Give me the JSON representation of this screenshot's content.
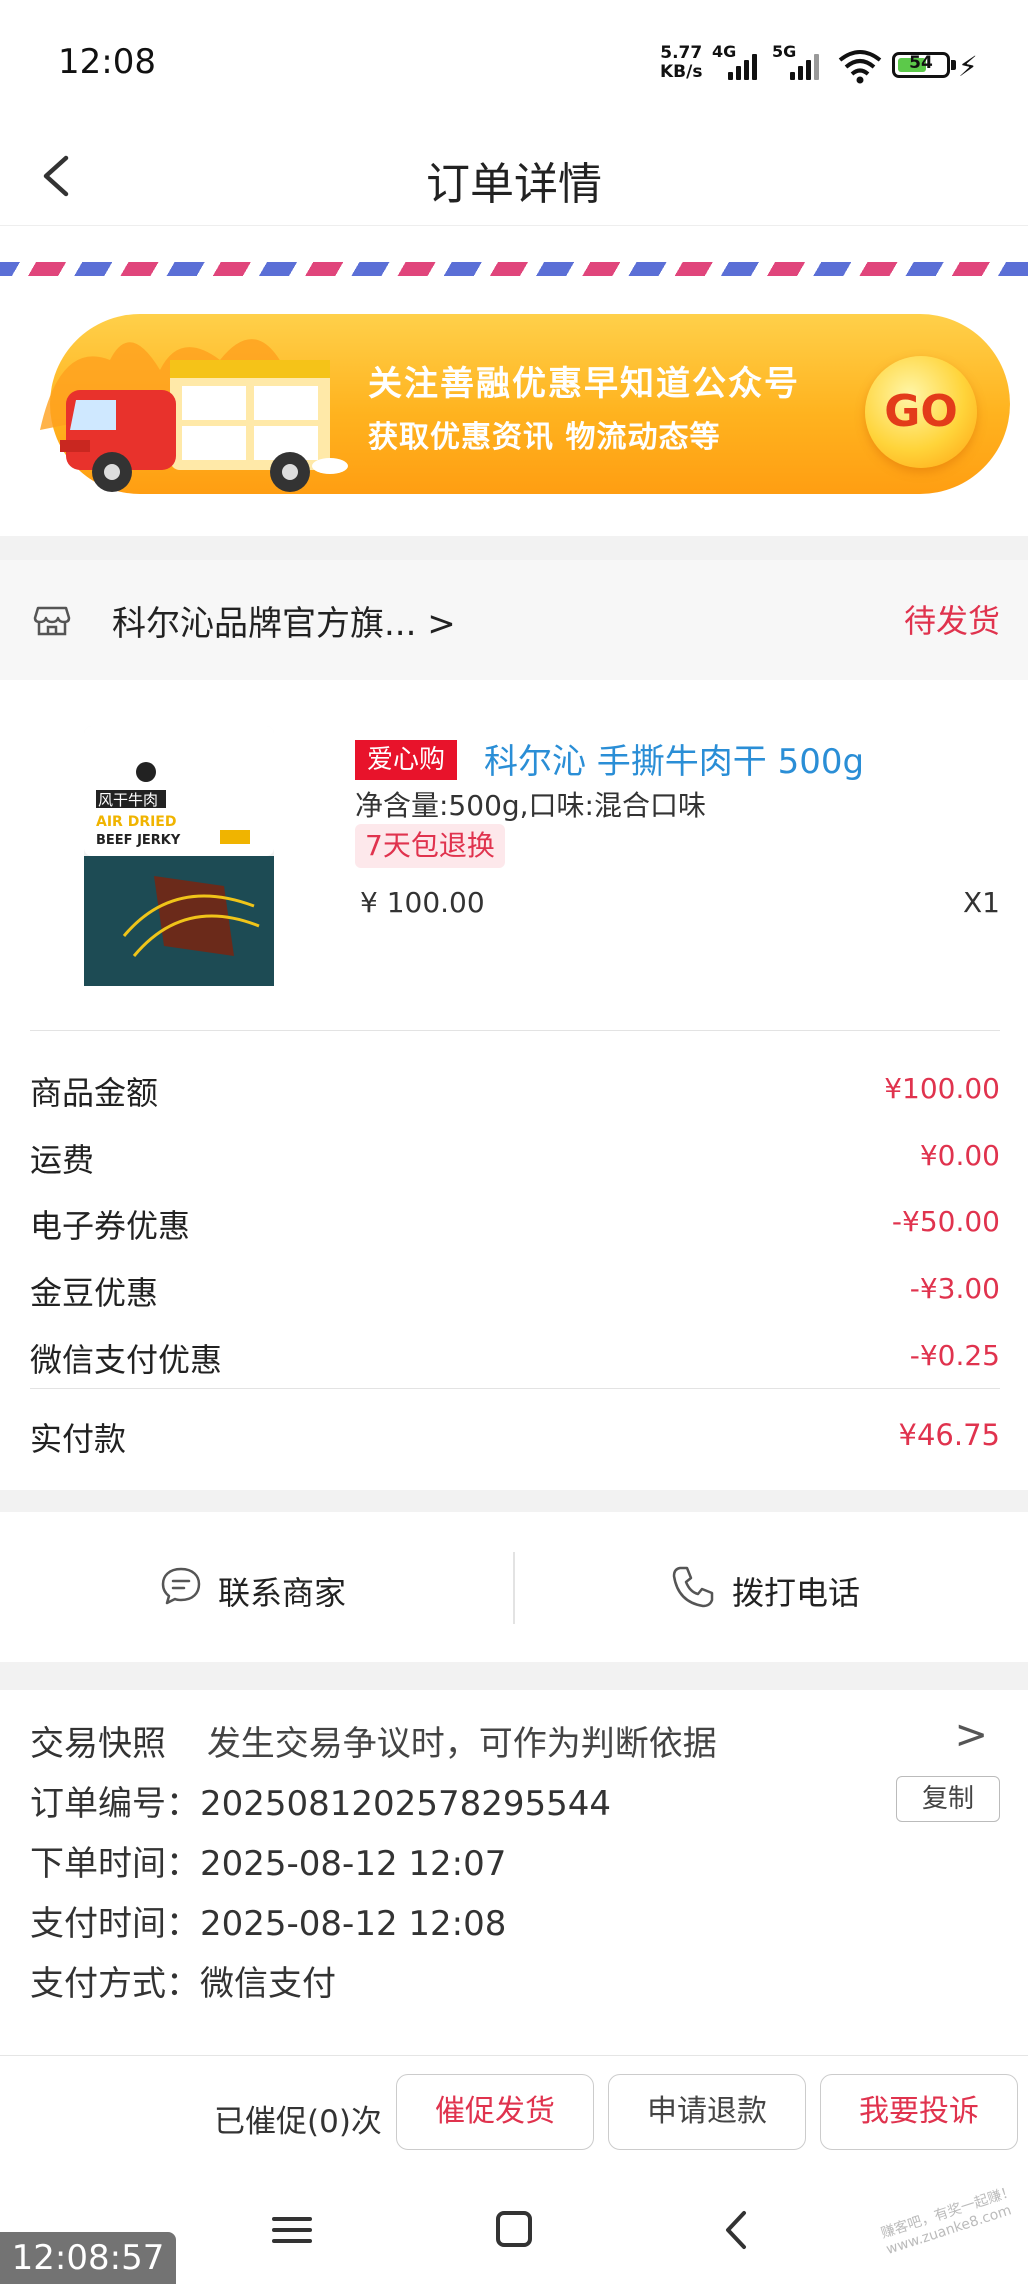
{
  "status_bar": {
    "time": "12:08",
    "net_speed": "5.77",
    "net_unit": "KB/s",
    "sig1": "4G",
    "sig2": "5G",
    "battery": "54"
  },
  "header": {
    "title": "订单详情"
  },
  "banner": {
    "line1": "关注善融优惠早知道公众号",
    "line2": "获取优惠资讯 物流动态等",
    "go_label": "GO"
  },
  "shop": {
    "name": "科尔沁品牌官方旗... >",
    "status": "待发货"
  },
  "product": {
    "tag": "爱心购",
    "title": "科尔沁 手撕牛肉干 500g",
    "spec": "净含量:500g,口味:混合口味",
    "return_tag": "7天包退换",
    "price": "¥ 100.00",
    "qty": "X1",
    "image_text1": "风干牛肉",
    "image_text2": "AIR DRIED",
    "image_text3": "BEEF JERKY"
  },
  "amounts": [
    {
      "label": "商品金额",
      "value": "¥100.00"
    },
    {
      "label": "运费",
      "value": "¥0.00"
    },
    {
      "label": "电子券优惠",
      "value": "-¥50.00"
    },
    {
      "label": "金豆优惠",
      "value": "-¥3.00"
    },
    {
      "label": "微信支付优惠",
      "value": "-¥0.25"
    }
  ],
  "paid": {
    "label": "实付款",
    "value": "¥46.75"
  },
  "actions": {
    "contact": "联系商家",
    "call": "拨打电话"
  },
  "info": {
    "snapshot_label": "交易快照",
    "snapshot_desc": "发生交易争议时，可作为判断依据",
    "snapshot_arrow": ">",
    "order_no_label": "订单编号：",
    "order_no": "2025081202578295544",
    "copy_label": "复制",
    "order_time_label": "下单时间：",
    "order_time": "2025-08-12 12:07",
    "pay_time_label": "支付时间：",
    "pay_time": "2025-08-12 12:08",
    "pay_method_label": "支付方式：",
    "pay_method": "微信支付"
  },
  "bottom": {
    "urge_count": "已催促(0)次",
    "urge_button": "催促发货",
    "refund_button": "申请退款",
    "complain_button": "我要投诉"
  },
  "overlay": {
    "timestamp": "12:08:57",
    "watermark": "赚客吧，有奖一起赚！ www.zuanke8.com"
  },
  "colors": {
    "accent_red": "#e0334e",
    "link_blue": "#2a8ed6",
    "banner_orange": "#ffb31f"
  }
}
